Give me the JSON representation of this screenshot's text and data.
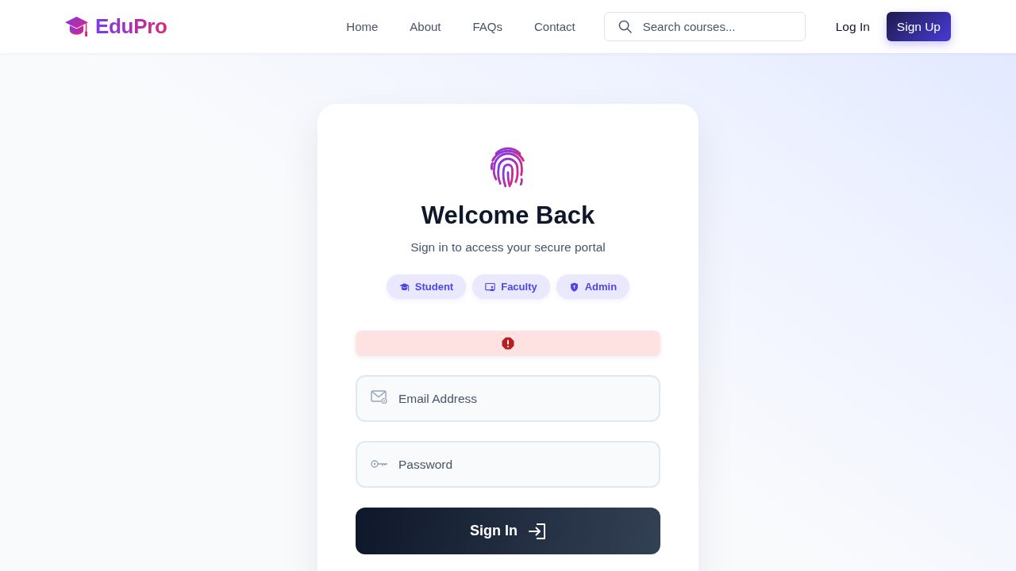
{
  "header": {
    "logo": "EduPro",
    "nav": [
      "Home",
      "About",
      "FAQs",
      "Contact"
    ],
    "search": {
      "placeholder": "Search courses..."
    },
    "login": "Log In",
    "signup": "Sign Up"
  },
  "card": {
    "title": "Welcome Back",
    "subtitle": "Sign in to access your secure portal",
    "roles": [
      {
        "kind": "student",
        "label": "Student",
        "selected": false
      },
      {
        "kind": "faculty",
        "label": "Faculty",
        "selected": false
      },
      {
        "kind": "admin",
        "label": "Admin",
        "selected": false
      }
    ],
    "alert": {
      "kind": "error"
    },
    "fields": [
      {
        "kind": "email",
        "placeholder": "Email Address"
      },
      {
        "kind": "password",
        "placeholder": "Password"
      }
    ],
    "submit": "Sign In"
  }
}
